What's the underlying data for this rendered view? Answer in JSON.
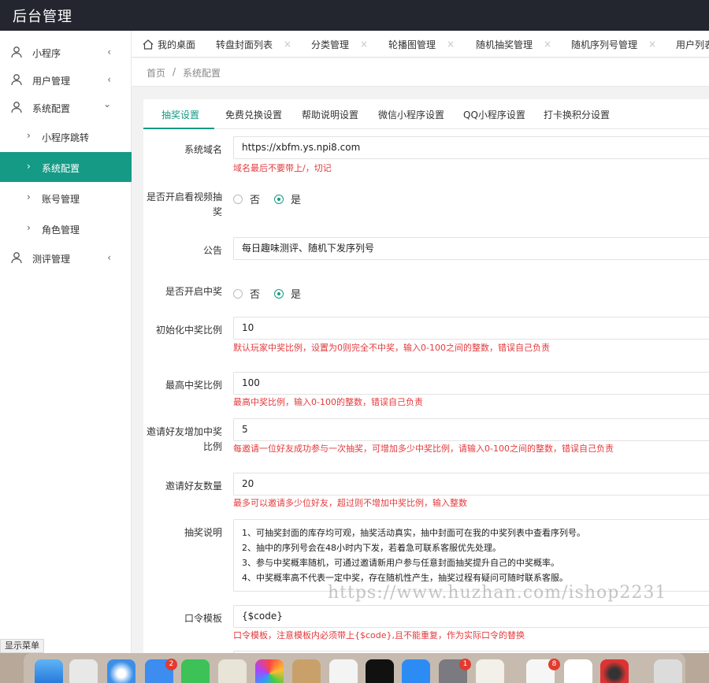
{
  "app": {
    "title": "后台管理"
  },
  "sidebar": {
    "items": [
      {
        "label": "小程序",
        "arrow": "‹"
      },
      {
        "label": "用户管理",
        "arrow": "‹"
      },
      {
        "label": "系统配置",
        "arrow": "⌄"
      },
      {
        "label": "小程序跳转",
        "chev": "›"
      },
      {
        "label": "系统配置",
        "chev": "›"
      },
      {
        "label": "账号管理",
        "chev": "›"
      },
      {
        "label": "角色管理",
        "chev": "›"
      },
      {
        "label": "测评管理",
        "arrow": "‹"
      }
    ],
    "toggle_label": "显示菜单"
  },
  "tabs": [
    {
      "label": "我的桌面"
    },
    {
      "label": "转盘封面列表",
      "close": "×"
    },
    {
      "label": "分类管理",
      "close": "×"
    },
    {
      "label": "轮播图管理",
      "close": "×"
    },
    {
      "label": "随机抽奖管理",
      "close": "×"
    },
    {
      "label": "随机序列号管理",
      "close": "×"
    },
    {
      "label": "用户列表"
    }
  ],
  "breadcrumb": {
    "home": "首页",
    "sep": "/",
    "current": "系统配置"
  },
  "settings_tabs": [
    "抽奖设置",
    "免费兑换设置",
    "帮助说明设置",
    "微信小程序设置",
    "QQ小程序设置",
    "打卡换积分设置"
  ],
  "form": {
    "domain": {
      "label": "系统域名",
      "value": "https://xbfm.ys.npi8.com",
      "hint": "域名最后不要带上/，切记"
    },
    "video_lottery": {
      "label": "是否开启看视频抽奖",
      "options": [
        "否",
        "是"
      ],
      "selected": "是"
    },
    "notice": {
      "label": "公告",
      "value": "每日趣味测评、随机下发序列号"
    },
    "win_enabled": {
      "label": "是否开启中奖",
      "options": [
        "否",
        "是"
      ],
      "selected": "是"
    },
    "init_rate": {
      "label": "初始化中奖比例",
      "value": "10",
      "hint": "默认玩家中奖比例，设置为0则完全不中奖，输入0-100之间的整数，错误自己负责"
    },
    "max_rate": {
      "label": "最高中奖比例",
      "value": "100",
      "hint": "最高中奖比例，输入0-100的整数，错误自己负责"
    },
    "invite_rate": {
      "label": "邀请好友增加中奖比例",
      "value": "5",
      "hint": "每邀请一位好友成功参与一次抽奖，可增加多少中奖比例，请输入0-100之间的整数，错误自己负责"
    },
    "invite_count": {
      "label": "邀请好友数量",
      "value": "20",
      "hint": "最多可以邀请多少位好友，超过则不增加中奖比例，输入整数"
    },
    "description": {
      "label": "抽奖说明",
      "lines": [
        "1、可抽奖封面的库存均可观，抽奖活动真实，抽中封面可在我的中奖列表中查看序列号。",
        "2、抽中的序列号会在48小时内下发，若着急可联系客服优先处理。",
        "3、参与中奖概率随机，可通过邀请新用户参与任意封面抽奖提升自己的中奖概率。",
        "4、中奖概率高不代表一定中奖，存在随机性产生，抽奖过程有疑问可随时联系客服。"
      ]
    },
    "code_template": {
      "label": "口令模板",
      "value": "{$code}",
      "hint": "口令模板，注意模板内必须带上{$code},且不能重复，作为实际口令的替换"
    }
  },
  "watermark": "https://www.huzhan.com/ishop2231",
  "dock": {
    "badges": [
      "2",
      "1",
      "8"
    ]
  },
  "colors": {
    "accent": "#159a86",
    "topbar": "#23262e",
    "hint": "#e4393c"
  }
}
